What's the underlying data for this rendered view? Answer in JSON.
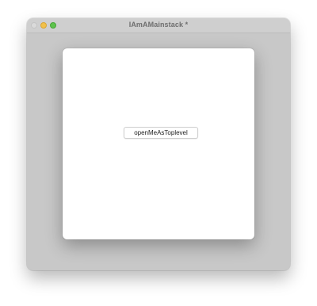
{
  "window": {
    "title": "IAmAMainstack *"
  },
  "sheet": {
    "button_label": "openMeAsToplevel"
  },
  "colors": {
    "window_bg": "#c8c8c8",
    "sheet_bg": "#ffffff",
    "close": "#dadada",
    "minimize": "#f2c14b",
    "zoom": "#5fc34e"
  }
}
